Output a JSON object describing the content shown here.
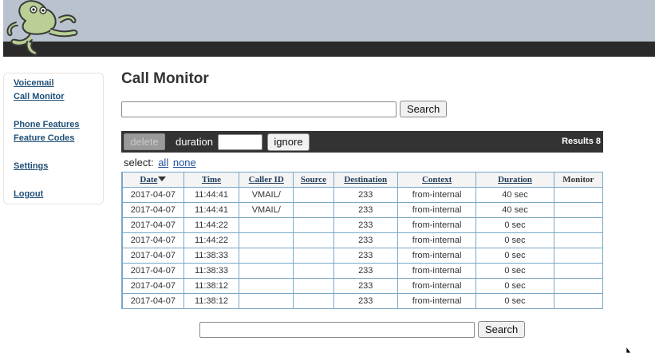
{
  "header": {
    "logo_icon": "frog-logo-icon"
  },
  "sidebar": {
    "items": [
      {
        "label": "Voicemail"
      },
      {
        "label": "Call Monitor"
      },
      {
        "label": "Phone Features"
      },
      {
        "label": "Feature Codes"
      },
      {
        "label": "Settings"
      },
      {
        "label": "Logout"
      }
    ]
  },
  "page": {
    "title": "Call Monitor"
  },
  "search_top": {
    "value": "",
    "button_label": "Search"
  },
  "toolbar": {
    "delete_label": "delete",
    "duration_label": "duration",
    "duration_value": "",
    "ignore_label": "ignore",
    "results_label": "Results 8"
  },
  "select": {
    "label": "select:",
    "all_label": "all",
    "none_label": "none"
  },
  "table": {
    "columns": [
      "Date",
      "Time",
      "Caller ID",
      "Source",
      "Destination",
      "Context",
      "Duration",
      "Monitor"
    ],
    "sorted_column": "Date",
    "rows": [
      [
        "2017-04-07",
        "11:44:41",
        "VMAIL/",
        "",
        "233",
        "from-internal",
        "40 sec",
        ""
      ],
      [
        "2017-04-07",
        "11:44:41",
        "VMAIL/",
        "",
        "233",
        "from-internal",
        "40 sec",
        ""
      ],
      [
        "2017-04-07",
        "11:44:22",
        "",
        "",
        "233",
        "from-internal",
        "0 sec",
        ""
      ],
      [
        "2017-04-07",
        "11:44:22",
        "",
        "",
        "233",
        "from-internal",
        "0 sec",
        ""
      ],
      [
        "2017-04-07",
        "11:38:33",
        "",
        "",
        "233",
        "from-internal",
        "0 sec",
        ""
      ],
      [
        "2017-04-07",
        "11:38:33",
        "",
        "",
        "233",
        "from-internal",
        "0 sec",
        ""
      ],
      [
        "2017-04-07",
        "11:38:12",
        "",
        "",
        "233",
        "from-internal",
        "0 sec",
        ""
      ],
      [
        "2017-04-07",
        "11:38:12",
        "",
        "",
        "233",
        "from-internal",
        "0 sec",
        ""
      ]
    ]
  },
  "search_bottom": {
    "value": "",
    "button_label": "Search"
  },
  "colors": {
    "header_bg": "#b9c3cf",
    "header_bar": "#2a2a2a",
    "toolbar_bg": "#333333",
    "link": "#1f4f77",
    "table_border": "#7aa7c7"
  }
}
